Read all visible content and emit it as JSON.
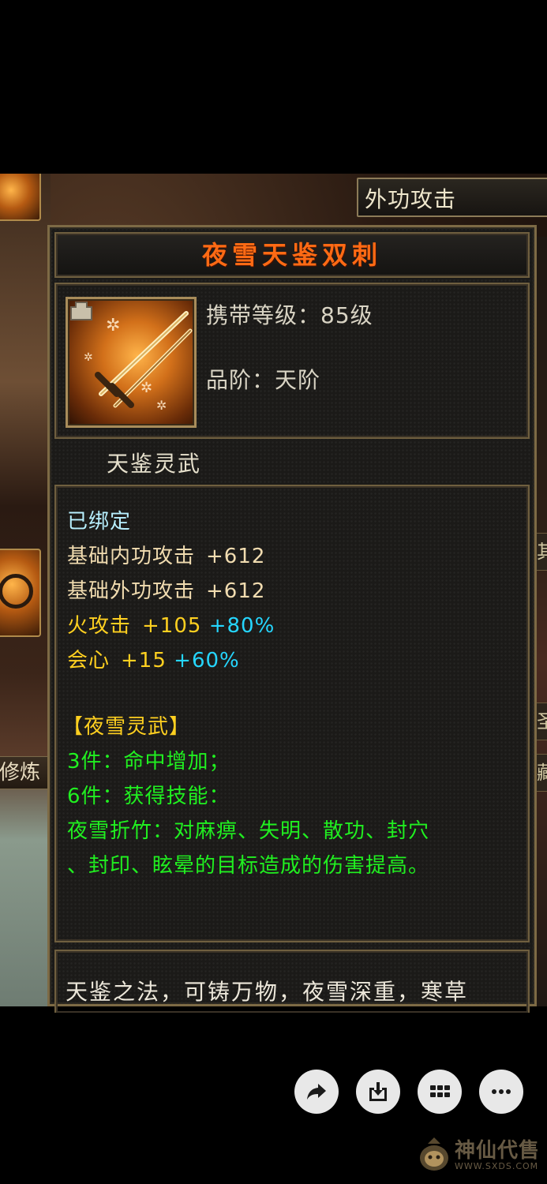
{
  "scene": {
    "top_tab_label": "外功攻击",
    "side_label": "修炼",
    "right_tabs": [
      "其",
      "圣",
      "藏"
    ]
  },
  "tooltip": {
    "item_name": "夜雪天鉴双刺",
    "carry_level": "携带等级：85级",
    "grade": "品阶：天阶",
    "set_type": "天鉴灵武",
    "bound_status": "已绑定",
    "stats": [
      {
        "name": "基础内功攻击",
        "base": "+612"
      },
      {
        "name": "基础外功攻击",
        "base": "+612"
      },
      {
        "name": "火攻击",
        "base": "+105",
        "bonus": "+80%"
      },
      {
        "name": "会心",
        "base": "+15",
        "bonus": "+60%"
      }
    ],
    "set_bonus": {
      "title": "【夜雪灵武】",
      "three_piece": "3件：命中增加；",
      "six_piece": "6件：获得技能：",
      "skill_line1": "夜雪折竹：对麻痹、失明、散功、封穴",
      "skill_line2": "、封印、眩晕的目标造成的伤害提高。"
    },
    "lore": "天鉴之法，可铸万物，夜雪深重，寒草"
  },
  "controls": {
    "icons": [
      "share-icon",
      "download-icon",
      "grid-icon",
      "more-icon"
    ]
  },
  "watermark": {
    "name": "神仙代售",
    "url": "WWW.SXDS.COM"
  },
  "colors": {
    "title": "#ff6a14",
    "stat": "#f1dcb0",
    "elemental": "#ffd020",
    "bonus_percent": "#25d6ff",
    "set_text": "#20f020",
    "bound": "#b8f0ff"
  }
}
